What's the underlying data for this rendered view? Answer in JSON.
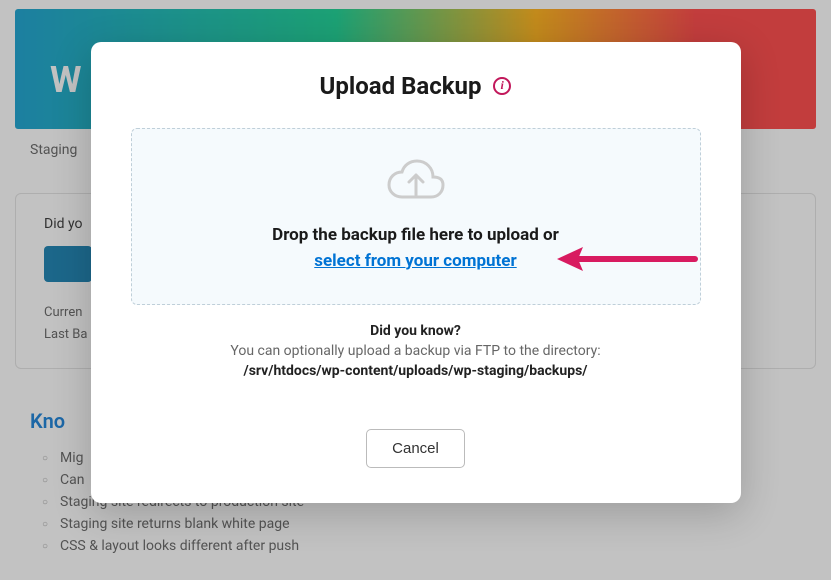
{
  "background": {
    "header_letter": "W",
    "tabs_text": "Staging",
    "card_did": "Did yo",
    "card_current": "Curren",
    "card_last": "Last Ba",
    "known_title": "Kno",
    "known_items": [
      "Mig",
      "Can",
      "Staging site redirects to production site",
      "Staging site returns blank white page",
      "CSS & layout looks different after push"
    ]
  },
  "modal": {
    "title": "Upload Backup",
    "dropzone_text": "Drop the backup file here to upload or",
    "select_link": "select from your computer",
    "dyk_title": "Did you know?",
    "dyk_text": "You can optionally upload a backup via FTP to the directory:",
    "dyk_path": "/srv/htdocs/wp-content/uploads/wp-staging/backups/",
    "cancel": "Cancel"
  }
}
